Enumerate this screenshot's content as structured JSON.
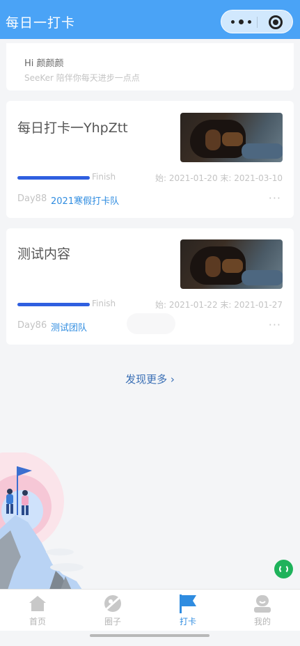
{
  "header": {
    "title": "每日一打卡"
  },
  "greeting": {
    "hi": "Hi 颜颜颜",
    "sub": "SeeKer 陪伴你每天进步一点点"
  },
  "tasks": [
    {
      "title": "每日打卡一YhpZtt",
      "progress": 1.0,
      "finish_label": "Finish",
      "dates": "始: 2021-01-20   末: 2021-03-10",
      "day": "Day88",
      "team": "2021寒假打卡队",
      "more": "···"
    },
    {
      "title": "测试内容",
      "progress": 1.0,
      "finish_label": "Finish",
      "dates": "始: 2021-01-22   末: 2021-01-27",
      "day": "Day86",
      "team": "测试团队",
      "more": "···"
    }
  ],
  "discover": {
    "label": "发现更多 ›"
  },
  "tabbar": {
    "items": [
      {
        "label": "首页",
        "icon": "home-icon",
        "active": false
      },
      {
        "label": "圈子",
        "icon": "circle-icon",
        "active": false
      },
      {
        "label": "打卡",
        "icon": "flag-icon",
        "active": true
      },
      {
        "label": "我的",
        "icon": "profile-icon",
        "active": false
      }
    ]
  },
  "colors": {
    "header": "#4aa3f6",
    "accent": "#2f8ce0",
    "progress": "#2f5fe0",
    "float_button": "#1fb25b"
  }
}
